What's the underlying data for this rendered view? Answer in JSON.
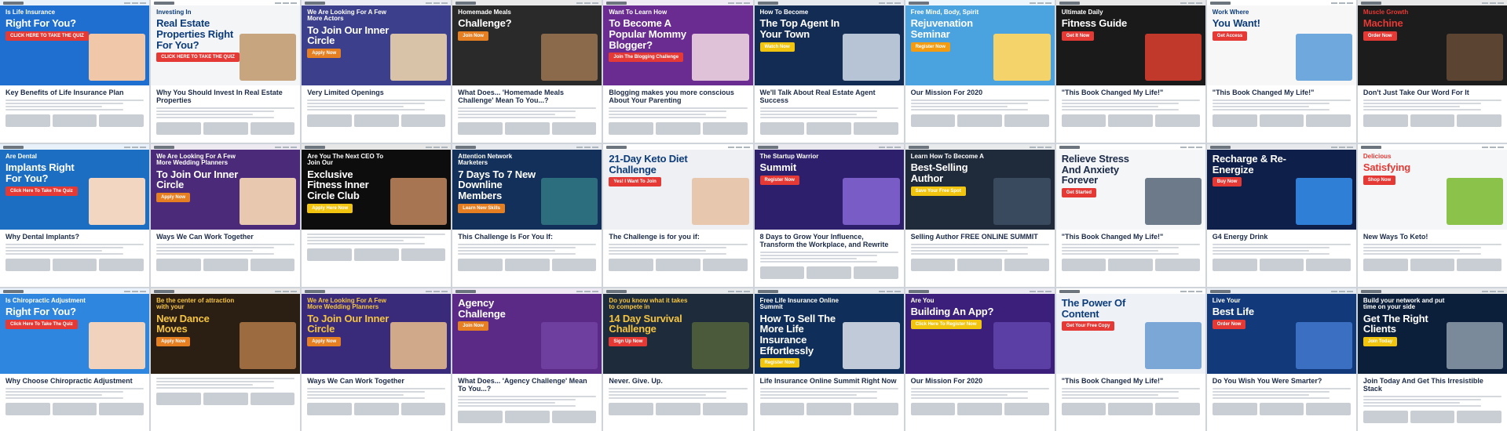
{
  "tiles": [
    {
      "bg": "#1e6fd0",
      "fg": "#ffffff",
      "accent": "#e53935",
      "pre": "Is Life Insurance",
      "headline": "Right For You?",
      "cta": "CLICK HERE TO TAKE THE QUIZ",
      "lower": "Key Benefits of Life Insurance Plan",
      "photo": "#f0c7a8"
    },
    {
      "bg": "#f3f5f7",
      "fg": "#0d3c7a",
      "accent": "#e53935",
      "pre": "Investing In",
      "headline": "Real Estate Properties Right For You?",
      "cta": "CLICK HERE TO TAKE THE QUIZ",
      "lower": "Why You Should Invest In Real Estate Properties",
      "photo": "#c7a57f"
    },
    {
      "bg": "#3b3f8c",
      "fg": "#ffffff",
      "accent": "#e67e22",
      "pre": "We Are Looking For A Few More Actors",
      "headline": "To Join Our Inner Circle",
      "cta": "Apply Now",
      "lower": "Very Limited Openings",
      "photo": "#d9c3a8"
    },
    {
      "bg": "#2a2a2a",
      "fg": "#ffffff",
      "accent": "#e67e22",
      "pre": "Homemade Meals",
      "headline": "Challenge?",
      "cta": "Join Now",
      "lower": "What Does... 'Homemade Meals Challenge' Mean To You...?",
      "photo": "#8a6a4a"
    },
    {
      "bg": "#6a2c91",
      "fg": "#ffffff",
      "accent": "#e53935",
      "pre": "Want To Learn How",
      "headline": "To Become A Popular Mommy Blogger?",
      "cta": "Join The Blogging Challenge",
      "lower": "Blogging makes you more conscious About Your Parenting",
      "photo": "#e0c2d8"
    },
    {
      "bg": "#132c54",
      "fg": "#ffffff",
      "accent": "#f1c40f",
      "pre": "How To Become",
      "headline": "The Top Agent In Your Town",
      "cta": "Watch Now",
      "lower": "We'll Talk About Real Estate Agent Success",
      "photo": "#b7c4d6"
    },
    {
      "bg": "#4aa3df",
      "fg": "#ffffff",
      "accent": "#f39c12",
      "pre": "Free Mind, Body, Spirit",
      "headline": "Rejuvenation Seminar",
      "cta": "Register Now",
      "lower": "Our Mission For 2020",
      "photo": "#f4d36b"
    },
    {
      "bg": "#1a1a1a",
      "fg": "#ffffff",
      "accent": "#e53935",
      "pre": "Ultimate Daily",
      "headline": "Fitness Guide",
      "cta": "Get It Now",
      "lower": "\"This Book Changed My Life!\"",
      "photo": "#c0392b"
    },
    {
      "bg": "#f7f7f7",
      "fg": "#0d3c7a",
      "accent": "#e53935",
      "pre": "Work Where",
      "headline": "You Want!",
      "cta": "Get Access",
      "lower": "\"This Book Changed My Life!\"",
      "photo": "#6fa8dc"
    },
    {
      "bg": "#1c1c1c",
      "fg": "#e53935",
      "accent": "#e53935",
      "pre": "Muscle Growth",
      "headline": "Machine",
      "cta": "Order Now",
      "lower": "Don't Just Take Our Word For It",
      "photo": "#5c4433"
    },
    {
      "bg": "#1b6ec2",
      "fg": "#ffffff",
      "accent": "#e53935",
      "pre": "Are Dental",
      "headline": "Implants Right For You?",
      "cta": "Click Here To Take The Quiz",
      "lower": "Why Dental Implants?",
      "photo": "#f2d6c1"
    },
    {
      "bg": "#4b2a7a",
      "fg": "#ffffff",
      "accent": "#e67e22",
      "pre": "We Are Looking For A Few More Wedding Planners",
      "headline": "To Join Our Inner Circle",
      "cta": "Apply Now",
      "lower": "Ways We Can Work Together",
      "photo": "#e8c9b0"
    },
    {
      "bg": "#0d0d0d",
      "fg": "#ffffff",
      "accent": "#f1c40f",
      "pre": "Are You The Next CEO To Join Our",
      "headline": "Exclusive Fitness Inner Circle Club",
      "cta": "Apply Here Now",
      "lower": "",
      "photo": "#a87552"
    },
    {
      "bg": "#12305a",
      "fg": "#ffffff",
      "accent": "#e67e22",
      "pre": "Attention Network Marketers",
      "headline": "7 Days To 7 New Downline Members",
      "cta": "Learn New Skills",
      "lower": "This Challenge Is For You If:",
      "photo": "#2c6e7e"
    },
    {
      "bg": "#eef0f3",
      "fg": "#0d3c7a",
      "accent": "#e53935",
      "pre": "",
      "headline": "21-Day Keto Diet Challenge",
      "cta": "Yes! I Want To Join",
      "lower": "The Challenge is for you if:",
      "photo": "#e7c7ad"
    },
    {
      "bg": "#2d1f6b",
      "fg": "#ffffff",
      "accent": "#e53935",
      "pre": "The Startup Warrior",
      "headline": "Summit",
      "cta": "Register Now",
      "lower": "8 Days to Grow Your Influence, Transform the Workplace, and Rewrite",
      "photo": "#7a5cc7"
    },
    {
      "bg": "#1f2a3a",
      "fg": "#ffffff",
      "accent": "#f1c40f",
      "pre": "Learn How To Become A",
      "headline": "Best-Selling Author",
      "cta": "Save Your Free Spot",
      "lower": "Selling Author FREE ONLINE SUMMIT",
      "photo": "#3a4a5e"
    },
    {
      "bg": "#f5f6f8",
      "fg": "#1b2b48",
      "accent": "#e53935",
      "pre": "",
      "headline": "Relieve Stress And Anxiety Forever",
      "cta": "Get Started",
      "lower": "\"This Book Changed My Life!\"",
      "photo": "#6c7a89"
    },
    {
      "bg": "#0e1f4a",
      "fg": "#ffffff",
      "accent": "#e53935",
      "pre": "",
      "headline": "Recharge & Re-Energize",
      "cta": "Buy Now",
      "lower": "G4 Energy Drink",
      "photo": "#2f7fd6"
    },
    {
      "bg": "#f5f6f8",
      "fg": "#e53935",
      "accent": "#e53935",
      "pre": "Delicious",
      "headline": "Satisfying",
      "cta": "Shop Now",
      "lower": "New Ways To Keto!",
      "photo": "#8bc34a"
    },
    {
      "bg": "#2e86de",
      "fg": "#ffffff",
      "accent": "#e53935",
      "pre": "Is Chiropractic Adjustment",
      "headline": "Right For You?",
      "cta": "Click Here To Take The Quiz",
      "lower": "Why Choose Chiropractic Adjustment",
      "photo": "#f1d2bd"
    },
    {
      "bg": "#2b1e12",
      "fg": "#f5c542",
      "accent": "#e67e22",
      "pre": "Be the center of attraction with your",
      "headline": "New Dance Moves",
      "cta": "Apply Now",
      "lower": "",
      "photo": "#9c6b3f"
    },
    {
      "bg": "#3a2a7a",
      "fg": "#f5c542",
      "accent": "#e67e22",
      "pre": "We Are Looking For A Few More Wedding Planners",
      "headline": "To Join Our Inner Circle",
      "cta": "Apply Now",
      "lower": "Ways We Can Work Together",
      "photo": "#cfa98a"
    },
    {
      "bg": "#5b2a86",
      "fg": "#ffffff",
      "accent": "#e67e22",
      "pre": "",
      "headline": "Agency Challenge",
      "cta": "Join Now",
      "lower": "What Does... 'Agency Challenge' Mean To You...?",
      "photo": "#6f3fa0"
    },
    {
      "bg": "#1d2b3a",
      "fg": "#f5c542",
      "accent": "#e53935",
      "pre": "Do you know what it takes to compete in",
      "headline": "14 Day Survival Challenge",
      "cta": "Sign Up Now",
      "lower": "Never. Give. Up.",
      "photo": "#4a5a3a"
    },
    {
      "bg": "#0f2f5a",
      "fg": "#ffffff",
      "accent": "#f1c40f",
      "pre": "Free Life Insurance Online Summit",
      "headline": "How To Sell The More Life Insurance Effortlessly",
      "cta": "Register Now",
      "lower": "Life Insurance Online Summit Right Now",
      "photo": "#c0cad8"
    },
    {
      "bg": "#3b1f7a",
      "fg": "#ffffff",
      "accent": "#f1c40f",
      "pre": "Are You",
      "headline": "Building An App?",
      "cta": "Click Here To Register Now",
      "lower": "Our Mission For 2020",
      "photo": "#5b3fa5"
    },
    {
      "bg": "#eef2f7",
      "fg": "#0d3c7a",
      "accent": "#e53935",
      "pre": "",
      "headline": "The Power Of Content",
      "cta": "Get Your Free Copy",
      "lower": "\"This Book Changed My Life!\"",
      "photo": "#7aa7d6"
    },
    {
      "bg": "#123a7a",
      "fg": "#ffffff",
      "accent": "#e53935",
      "pre": "Live Your",
      "headline": "Best Life",
      "cta": "Order Now",
      "lower": "Do You Wish You Were Smarter?",
      "photo": "#3a6fc2"
    },
    {
      "bg": "#0b1f3a",
      "fg": "#ffffff",
      "accent": "#f1c40f",
      "pre": "Build your network and put time on your side",
      "headline": "Get The Right Clients",
      "cta": "Join Today",
      "lower": "Join Today And Get This Irresistible Stack",
      "photo": "#7a8a9a"
    }
  ]
}
